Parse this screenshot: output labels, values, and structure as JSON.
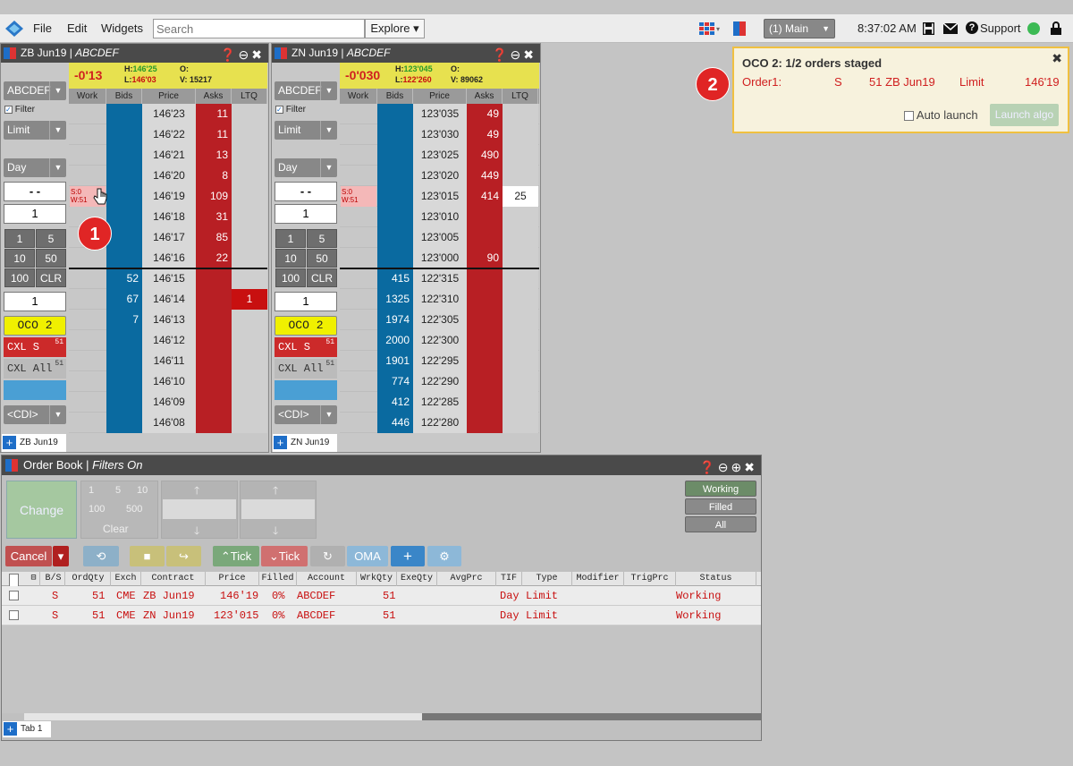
{
  "menu": {
    "file": "File",
    "edit": "Edit",
    "widgets": "Widgets",
    "search_placeholder": "Search",
    "explore": "Explore ▾"
  },
  "topbar": {
    "workspace": "(1) Main",
    "time": "8:37:02 AM",
    "support": "Support"
  },
  "colors": {
    "bid": "#0a6aa0",
    "ask": "#b81f24",
    "header_yellow": "#e7e14f",
    "oco": "#f0f000",
    "status_green": "#3cba54"
  },
  "columns": {
    "work": "Work",
    "bids": "Bids",
    "price": "Price",
    "asks": "Asks",
    "ltq": "LTQ"
  },
  "zb": {
    "title": "ZB Jun19",
    "account_italic": "ABCDEF",
    "change": "-0'13",
    "high": "146'25",
    "low": "146'03",
    "open": "",
    "volume": "15217",
    "h_lbl": "H:",
    "l_lbl": "L:",
    "o_lbl": "O:",
    "v_lbl": "V:",
    "account_sel": "ABCDEF",
    "filter": "Filter",
    "order_type": "Limit",
    "tif": "Day",
    "qty_display": "- -",
    "qty": "1",
    "qty2": "1",
    "keys": [
      "1",
      "5",
      "10",
      "50",
      "100",
      "CLR"
    ],
    "oco": "OCO 2",
    "cxl_s": "CXL S",
    "cxl_s_count": "51",
    "cxl_all": "CXL All",
    "cxl_all_count": "51",
    "cdi": "<CDI>",
    "tab": "ZB Jun19",
    "working_label": [
      "S:0",
      "W:51"
    ],
    "rows": [
      {
        "price": "146'23",
        "bid": "",
        "ask": "11",
        "ltq": ""
      },
      {
        "price": "146'22",
        "bid": "",
        "ask": "11",
        "ltq": ""
      },
      {
        "price": "146'21",
        "bid": "",
        "ask": "13",
        "ltq": ""
      },
      {
        "price": "146'20",
        "bid": "",
        "ask": "8",
        "ltq": ""
      },
      {
        "price": "146'19",
        "bid": "",
        "ask": "109",
        "ltq": ""
      },
      {
        "price": "146'18",
        "bid": "",
        "ask": "31",
        "ltq": ""
      },
      {
        "price": "146'17",
        "bid": "",
        "ask": "85",
        "ltq": ""
      },
      {
        "price": "146'16",
        "bid": "",
        "ask": "22",
        "ltq": ""
      },
      {
        "price": "146'15",
        "bid": "52",
        "ask": "",
        "ltq": ""
      },
      {
        "price": "146'14",
        "bid": "67",
        "ask": "",
        "ltq": "1"
      },
      {
        "price": "146'13",
        "bid": "7",
        "ask": "",
        "ltq": ""
      },
      {
        "price": "146'12",
        "bid": "",
        "ask": "",
        "ltq": ""
      },
      {
        "price": "146'11",
        "bid": "",
        "ask": "",
        "ltq": ""
      },
      {
        "price": "146'10",
        "bid": "",
        "ask": "",
        "ltq": ""
      },
      {
        "price": "146'09",
        "bid": "",
        "ask": "",
        "ltq": ""
      },
      {
        "price": "146'08",
        "bid": "",
        "ask": "",
        "ltq": ""
      }
    ]
  },
  "zn": {
    "title": "ZN Jun19",
    "account_italic": "ABCDEF",
    "change": "-0'030",
    "high": "123'045",
    "low": "122'260",
    "open": "",
    "volume": "89062",
    "h_lbl": "H:",
    "l_lbl": "L:",
    "o_lbl": "O:",
    "v_lbl": "V:",
    "account_sel": "ABCDEF",
    "filter": "Filter",
    "order_type": "Limit",
    "tif": "Day",
    "qty_display": "- -",
    "qty": "1",
    "qty2": "1",
    "keys": [
      "1",
      "5",
      "10",
      "50",
      "100",
      "CLR"
    ],
    "oco": "OCO 2",
    "cxl_s": "CXL S",
    "cxl_s_count": "51",
    "cxl_all": "CXL All",
    "cxl_all_count": "51",
    "cdi": "<CDI>",
    "tab": "ZN Jun19",
    "working_label": [
      "S:0",
      "W:51"
    ],
    "rows": [
      {
        "price": "123'035",
        "bid": "",
        "ask": "49",
        "ltq": ""
      },
      {
        "price": "123'030",
        "bid": "",
        "ask": "49",
        "ltq": ""
      },
      {
        "price": "123'025",
        "bid": "",
        "ask": "490",
        "ltq": ""
      },
      {
        "price": "123'020",
        "bid": "",
        "ask": "449",
        "ltq": ""
      },
      {
        "price": "123'015",
        "bid": "",
        "ask": "414",
        "ltq": "25"
      },
      {
        "price": "123'010",
        "bid": "",
        "ask": "",
        "ltq": ""
      },
      {
        "price": "123'005",
        "bid": "",
        "ask": "",
        "ltq": ""
      },
      {
        "price": "123'000",
        "bid": "",
        "ask": "90",
        "ltq": ""
      },
      {
        "price": "122'315",
        "bid": "415",
        "ask": "",
        "ltq": ""
      },
      {
        "price": "122'310",
        "bid": "1325",
        "ask": "",
        "ltq": ""
      },
      {
        "price": "122'305",
        "bid": "1974",
        "ask": "",
        "ltq": ""
      },
      {
        "price": "122'300",
        "bid": "2000",
        "ask": "",
        "ltq": ""
      },
      {
        "price": "122'295",
        "bid": "1901",
        "ask": "",
        "ltq": ""
      },
      {
        "price": "122'290",
        "bid": "774",
        "ask": "",
        "ltq": ""
      },
      {
        "price": "122'285",
        "bid": "412",
        "ask": "",
        "ltq": ""
      },
      {
        "price": "122'280",
        "bid": "446",
        "ask": "",
        "ltq": ""
      }
    ]
  },
  "popup": {
    "title": "OCO 2: 1/2 orders staged",
    "order_label": "Order1:",
    "side": "S",
    "qty_contract": "51 ZB Jun19",
    "type": "Limit",
    "price": "146'19",
    "auto_launch": "Auto launch",
    "launch_algo": "Launch algo"
  },
  "callouts": {
    "one": "1",
    "two": "2"
  },
  "orderbook": {
    "title": "Order Book",
    "title_italic": "Filters On",
    "change": "Change",
    "qty_keys": [
      "1",
      "5",
      "10",
      "100",
      "500"
    ],
    "clear": "Clear",
    "filters": [
      "Working",
      "Filled",
      "All"
    ],
    "toolbar": {
      "cancel": "Cancel",
      "tick_up": "Tick",
      "tick_down": "Tick",
      "oma": "OMA"
    },
    "headers": [
      "B/S",
      "OrdQty",
      "Exch",
      "Contract",
      "Price",
      "Filled",
      "Account",
      "WrkQty",
      "ExeQty",
      "AvgPrc",
      "TIF",
      "Type",
      "Modifier",
      "TrigPrc",
      "Status"
    ],
    "rows": [
      {
        "bs": "S",
        "ordqty": "51",
        "exch": "CME",
        "contract": "ZB Jun19",
        "price": "146'19",
        "filled": "0%",
        "account": "ABCDEF",
        "wrkqty": "51",
        "tif": "Day",
        "type": "Limit",
        "status": "Working"
      },
      {
        "bs": "S",
        "ordqty": "51",
        "exch": "CME",
        "contract": "ZN Jun19",
        "price": "123'015",
        "filled": "0%",
        "account": "ABCDEF",
        "wrkqty": "51",
        "tif": "Day",
        "type": "Limit",
        "status": "Working"
      }
    ],
    "tab": "Tab 1"
  }
}
